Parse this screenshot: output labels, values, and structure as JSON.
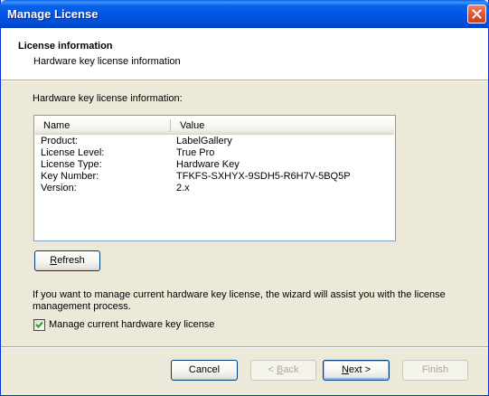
{
  "window": {
    "title": "Manage License"
  },
  "header": {
    "title": "License information",
    "subtitle": "Hardware key license information"
  },
  "section_label": "Hardware key license information:",
  "listview": {
    "columns": [
      "Name",
      "Value"
    ],
    "rows": [
      {
        "name": "Product:",
        "value": "LabelGallery"
      },
      {
        "name": "License Level:",
        "value": "True Pro"
      },
      {
        "name": "License Type:",
        "value": "Hardware Key"
      },
      {
        "name": "Key Number:",
        "value": "TFKFS-SXHYX-9SDH5-R6H7V-5BQ5P"
      },
      {
        "name": "Version:",
        "value": "2.x"
      }
    ]
  },
  "refresh_button": {
    "label_first": "R",
    "label_rest": "efresh"
  },
  "info_text": "If you want to manage current hardware key license, the wizard will assist you with the license management process.",
  "checkbox": {
    "label": "Manage current hardware key license",
    "checked": true
  },
  "footer": {
    "cancel": "Cancel",
    "back_prefix": "< ",
    "back_accel": "B",
    "back_rest": "ack",
    "next_accel": "N",
    "next_rest": "ext >",
    "finish": "Finish"
  },
  "colors": {
    "titlebar": "#0054e3",
    "dialog_bg": "#ece9d8",
    "close_button": "#d8583a"
  }
}
